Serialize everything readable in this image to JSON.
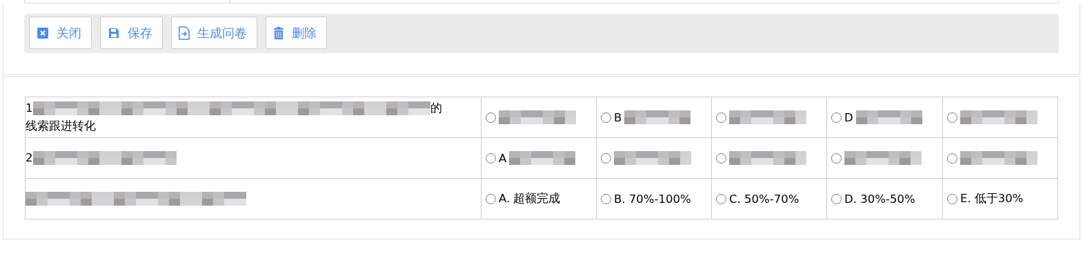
{
  "toolbar": {
    "buttons": [
      {
        "kind": "close",
        "label": "关闭"
      },
      {
        "kind": "save",
        "label": "保存"
      },
      {
        "kind": "generate",
        "label": "生成问卷"
      },
      {
        "kind": "delete",
        "label": "删除"
      }
    ]
  },
  "questions": [
    {
      "lines": [
        [
          {
            "kind": "text",
            "text": "1"
          },
          {
            "kind": "redacted"
          },
          {
            "kind": "text",
            "text": "的"
          }
        ],
        [
          {
            "kind": "text",
            "text": "线索跟进转化"
          }
        ]
      ],
      "options": [
        {
          "kind": "redacted",
          "selected": false
        },
        {
          "kind": "redacted",
          "label": "B",
          "selected": false
        },
        {
          "kind": "redacted",
          "selected": false
        },
        {
          "kind": "redacted",
          "label": "D",
          "selected": false
        },
        {
          "kind": "redacted",
          "selected": false
        }
      ]
    },
    {
      "lines": [
        [
          {
            "kind": "text",
            "text": "2"
          },
          {
            "kind": "redacted"
          }
        ]
      ],
      "options": [
        {
          "kind": "redacted",
          "label": "A",
          "selected": false
        },
        {
          "kind": "redacted",
          "selected": false
        },
        {
          "kind": "redacted",
          "selected": false
        },
        {
          "kind": "redacted",
          "selected": false
        },
        {
          "kind": "redacted",
          "selected": false
        }
      ]
    },
    {
      "lines": [
        [
          {
            "kind": "redacted"
          }
        ]
      ],
      "options": [
        {
          "kind": "text",
          "label": "A. 超额完成",
          "selected": false
        },
        {
          "kind": "text",
          "label": "B. 70%-100%",
          "selected": false
        },
        {
          "kind": "text",
          "label": "C. 50%-70%",
          "selected": false
        },
        {
          "kind": "text",
          "label": "D. 30%-50%",
          "selected": false
        },
        {
          "kind": "text",
          "label": "E. 低于30%",
          "selected": false
        }
      ]
    }
  ]
}
